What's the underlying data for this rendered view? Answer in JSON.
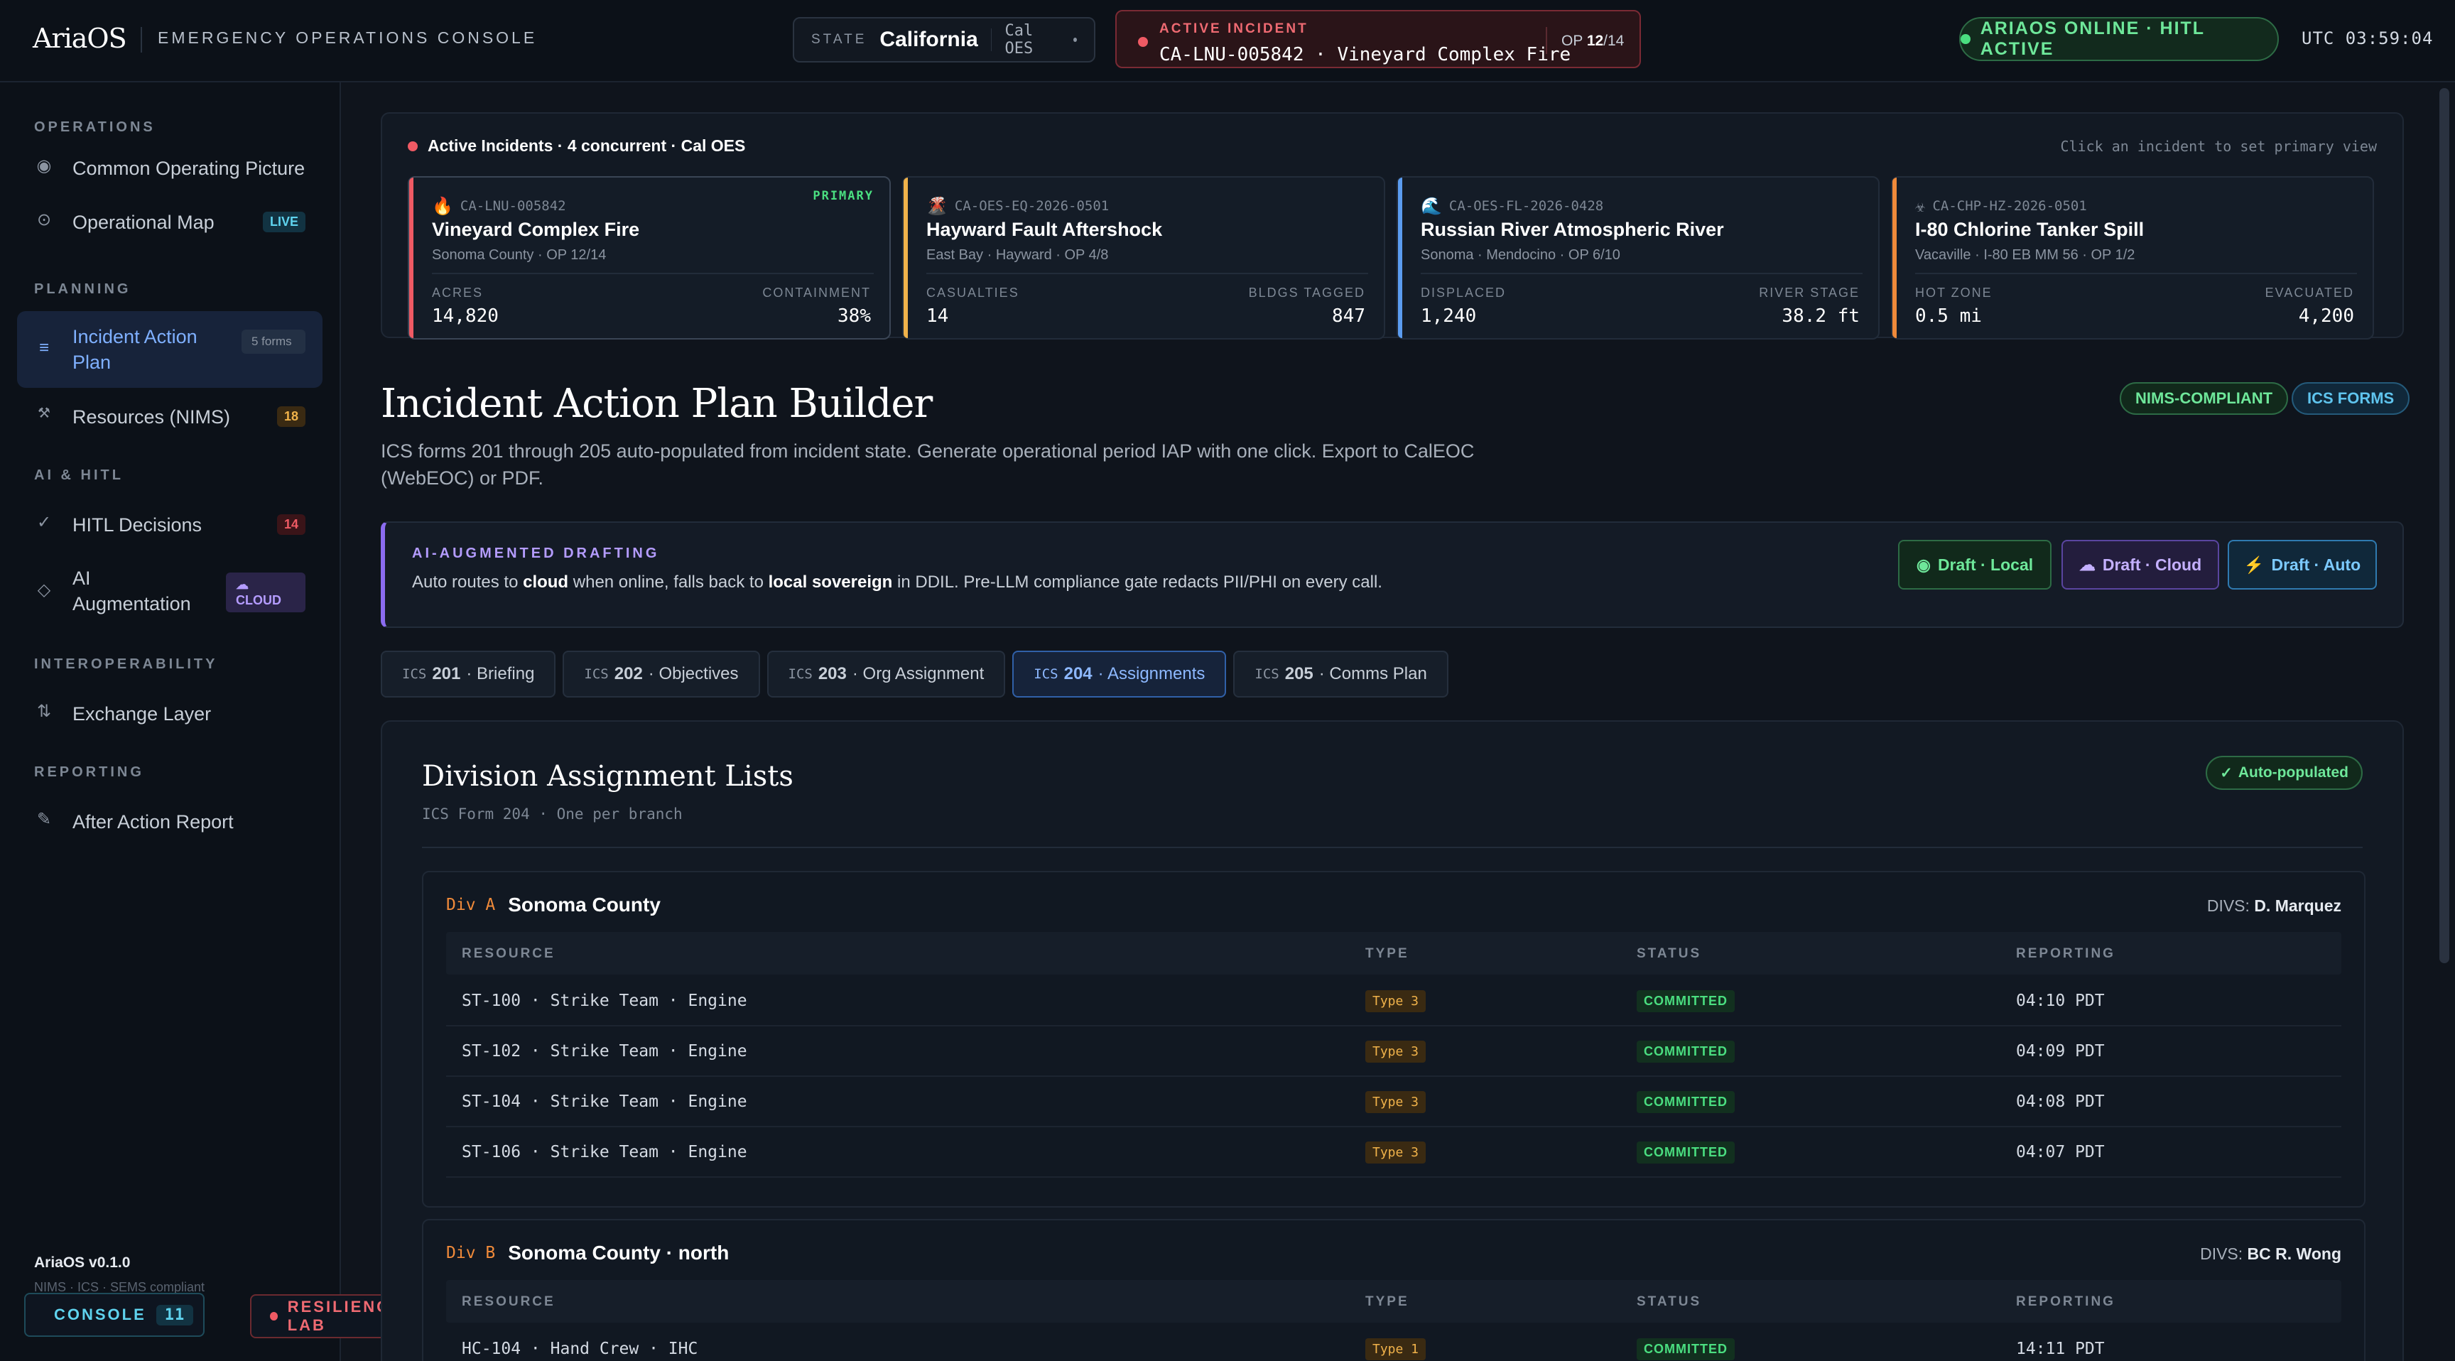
{
  "topbar": {
    "brand": "AriaOS",
    "subtitle": "EMERGENCY OPERATIONS CONSOLE",
    "state_label": "STATE",
    "state_value": "California",
    "state_agency": "Cal OES",
    "incident_label": "ACTIVE INCIDENT",
    "incident_value": "CA-LNU-005842 · Vineyard Complex Fire",
    "op_label": "OP",
    "op_value": "12",
    "op_total": "/14",
    "online": "ARIAOS ONLINE · HITL ACTIVE",
    "utc": "UTC 03:59:04"
  },
  "sidebar": {
    "sections": {
      "operations": "OPERATIONS",
      "planning": "PLANNING",
      "ai": "AI & HITL",
      "interop": "INTEROPERABILITY",
      "reporting": "REPORTING"
    },
    "items": {
      "cop": {
        "label": "Common Operating Picture",
        "icon": "target-icon"
      },
      "map": {
        "label": "Operational Map",
        "badge": "LIVE",
        "icon": "crosshair-icon"
      },
      "iap": {
        "label": "Incident Action Plan",
        "badge": "5 forms",
        "icon": "list-icon"
      },
      "resources": {
        "label": "Resources (NIMS)",
        "badge": "18",
        "icon": "tools-icon"
      },
      "hitl": {
        "label": "HITL Decisions",
        "badge": "14",
        "icon": "check-icon"
      },
      "ai_aug": {
        "label": "AI Augmentation",
        "badge": "☁ CLOUD",
        "icon": "diamond-icon"
      },
      "exchange": {
        "label": "Exchange Layer",
        "icon": "swap-icon"
      },
      "aar": {
        "label": "After Action Report",
        "icon": "pencil-icon"
      }
    },
    "version": "AriaOS v0.1.0",
    "compliance": "NIMS · ICS · SEMS compliant",
    "console_label": "CONSOLE",
    "console_count": "11",
    "lab_label": "RESILIENCE LAB"
  },
  "incidents": {
    "header": "Active Incidents · 4 concurrent · Cal OES",
    "hint": "Click an incident to set primary view",
    "primary_label": "PRIMARY",
    "cards": [
      {
        "id": "CA-LNU-005842",
        "icon": "🔥",
        "name": "Vineyard Complex Fire",
        "loc": "Sonoma County · OP 12/14",
        "k1": "ACRES",
        "v1": "14,820",
        "k2": "CONTAINMENT",
        "v2": "38%",
        "color": "#ef5a64"
      },
      {
        "id": "CA-OES-EQ-2026-0501",
        "icon": "🌋",
        "name": "Hayward Fault Aftershock",
        "loc": "East Bay · Hayward · OP 4/8",
        "k1": "CASUALTIES",
        "v1": "14",
        "k2": "BLDGS TAGGED",
        "v2": "847",
        "color": "#f0b24a"
      },
      {
        "id": "CA-OES-FL-2026-0428",
        "icon": "🌊",
        "name": "Russian River Atmospheric River",
        "loc": "Sonoma · Mendocino · OP 6/10",
        "k1": "DISPLACED",
        "v1": "1,240",
        "k2": "RIVER STAGE",
        "v2": "38.2 ft",
        "color": "#5b9cf0"
      },
      {
        "id": "CA-CHP-HZ-2026-0501",
        "icon": "☣",
        "name": "I-80 Chlorine Tanker Spill",
        "loc": "Vacaville · I-80 EB MM 56 · OP 1/2",
        "k1": "HOT ZONE",
        "v1": "0.5 mi",
        "k2": "EVACUATED",
        "v2": "4,200",
        "color": "#f08a3a"
      }
    ]
  },
  "builder": {
    "title": "Incident Action Plan Builder",
    "tag_nims": "NIMS-COMPLIANT",
    "tag_ics": "ICS FORMS",
    "desc": "ICS forms 201 through 205 auto-populated from incident state. Generate operational period IAP with one click. Export to CalEOC (WebEOC) or PDF.",
    "ai_label": "AI-AUGMENTED DRAFTING",
    "ai_text_1": "Auto routes to ",
    "ai_bold_1": "cloud",
    "ai_text_2": " when online, falls back to ",
    "ai_bold_2": "local sovereign",
    "ai_text_3": " in DDIL. Pre-LLM compliance gate redacts PII/PHI on every call.",
    "draft_local": "Draft · Local",
    "draft_cloud": "Draft · Cloud",
    "draft_auto": "Draft · Auto"
  },
  "tabs": [
    {
      "pre": "ICS",
      "num": "201",
      "label": "· Briefing"
    },
    {
      "pre": "ICS",
      "num": "202",
      "label": "· Objectives"
    },
    {
      "pre": "ICS",
      "num": "203",
      "label": "· Org Assignment"
    },
    {
      "pre": "ICS",
      "num": "204",
      "label": "· Assignments"
    },
    {
      "pre": "ICS",
      "num": "205",
      "label": "· Comms Plan"
    }
  ],
  "panel": {
    "title": "Division Assignment Lists",
    "subtitle": "ICS Form 204 · One per branch",
    "auto_label": "Auto-populated",
    "columns": [
      "RESOURCE",
      "TYPE",
      "STATUS",
      "REPORTING"
    ],
    "divisions": [
      {
        "code": "Div A",
        "name": "Sonoma County",
        "sup_label": "DIVS:",
        "sup_name": "D. Marquez",
        "rows": [
          {
            "resource": "ST-100 · Strike Team · Engine",
            "type": "Type 3",
            "status": "COMMITTED",
            "reporting": "04:10 PDT"
          },
          {
            "resource": "ST-102 · Strike Team · Engine",
            "type": "Type 3",
            "status": "COMMITTED",
            "reporting": "04:09 PDT"
          },
          {
            "resource": "ST-104 · Strike Team · Engine",
            "type": "Type 3",
            "status": "COMMITTED",
            "reporting": "04:08 PDT"
          },
          {
            "resource": "ST-106 · Strike Team · Engine",
            "type": "Type 3",
            "status": "COMMITTED",
            "reporting": "04:07 PDT"
          }
        ]
      },
      {
        "code": "Div B",
        "name": "Sonoma County · north",
        "sup_label": "DIVS:",
        "sup_name": "BC R. Wong",
        "rows": [
          {
            "resource": "HC-104 · Hand Crew · IHC",
            "type": "Type 1",
            "status": "COMMITTED",
            "reporting": "14:11 PDT"
          }
        ]
      }
    ]
  }
}
